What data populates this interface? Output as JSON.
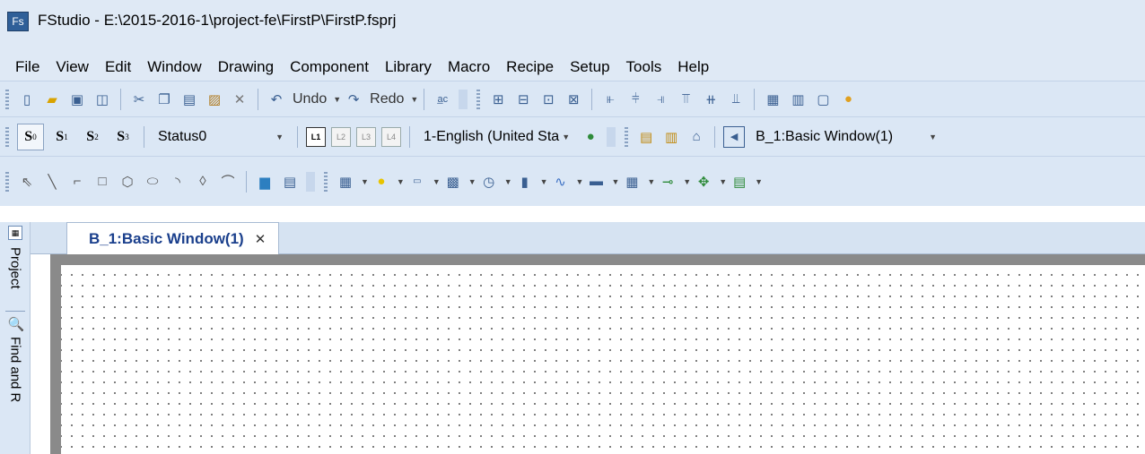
{
  "window": {
    "app_icon_text": "Fs",
    "title": "FStudio - E:\\2015-2016-1\\project-fe\\FirstP\\FirstP.fsprj"
  },
  "menu": [
    "File",
    "View",
    "Edit",
    "Window",
    "Drawing",
    "Component",
    "Library",
    "Macro",
    "Recipe",
    "Setup",
    "Tools",
    "Help"
  ],
  "toolbar1": {
    "undo_label": "Undo",
    "redo_label": "Redo",
    "icons": [
      "new-file-icon",
      "open-folder-icon",
      "save-icon",
      "save-all-icon",
      "cut-icon",
      "copy-icon",
      "copy-format-icon",
      "paste-icon",
      "delete-icon",
      "undo-icon",
      "redo-icon",
      "text-replace-icon",
      "grid-icon",
      "align-left-icon",
      "align-center-icon",
      "align-right-icon",
      "align-top-icon",
      "align-middle-icon",
      "align-bottom-icon",
      "distribute-h-icon",
      "distribute-v-icon",
      "group-icon",
      "ungroup-icon",
      "palette-icon"
    ]
  },
  "toolbar2": {
    "states": [
      {
        "label": "S",
        "sub": "0",
        "active": true
      },
      {
        "label": "S",
        "sub": "1",
        "active": false
      },
      {
        "label": "S",
        "sub": "2",
        "active": false
      },
      {
        "label": "S",
        "sub": "3",
        "active": false
      }
    ],
    "status_value": "Status0",
    "layers": [
      {
        "label": "L1",
        "active": true
      },
      {
        "label": "L2",
        "active": false
      },
      {
        "label": "L3",
        "active": false
      },
      {
        "label": "L4",
        "active": false
      }
    ],
    "language_value": "1-English (United Sta",
    "window_value": "B_1:Basic Window(1)"
  },
  "toolbar3": {
    "icons": [
      "pointer-icon",
      "line-icon",
      "polyline-icon",
      "rectangle-icon",
      "polygon-icon",
      "ellipse-icon",
      "arc-icon",
      "diamond-icon",
      "curve-icon",
      "picture-icon",
      "text-icon",
      "button-icon",
      "lamp-icon",
      "numeric-input-icon",
      "switch-icon",
      "clock-icon",
      "bar-graph-icon",
      "trend-chart-icon",
      "meter-icon",
      "table-icon",
      "slider-icon",
      "alarm-icon",
      "function-icon"
    ]
  },
  "dock": {
    "tabs": [
      "Project",
      "Find and R"
    ]
  },
  "document": {
    "tab_title": "B_1:Basic Window(1)",
    "close_glyph": "✕"
  },
  "colors": {
    "chrome": "#dfe9f5",
    "tab_text": "#1a3f8c",
    "canvas_border": "#8a8a8a"
  }
}
